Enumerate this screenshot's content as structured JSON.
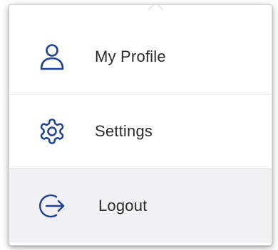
{
  "menu": {
    "items": [
      {
        "label": "My Profile",
        "icon": "user-icon"
      },
      {
        "label": "Settings",
        "icon": "gear-icon"
      },
      {
        "label": "Logout",
        "icon": "logout-icon"
      }
    ],
    "active_item": "Logout"
  },
  "colors": {
    "icon": "#1f3f8f",
    "text": "#2b2b2b",
    "hover_background": "#f1f1f3",
    "divider": "#e6e6e6"
  }
}
